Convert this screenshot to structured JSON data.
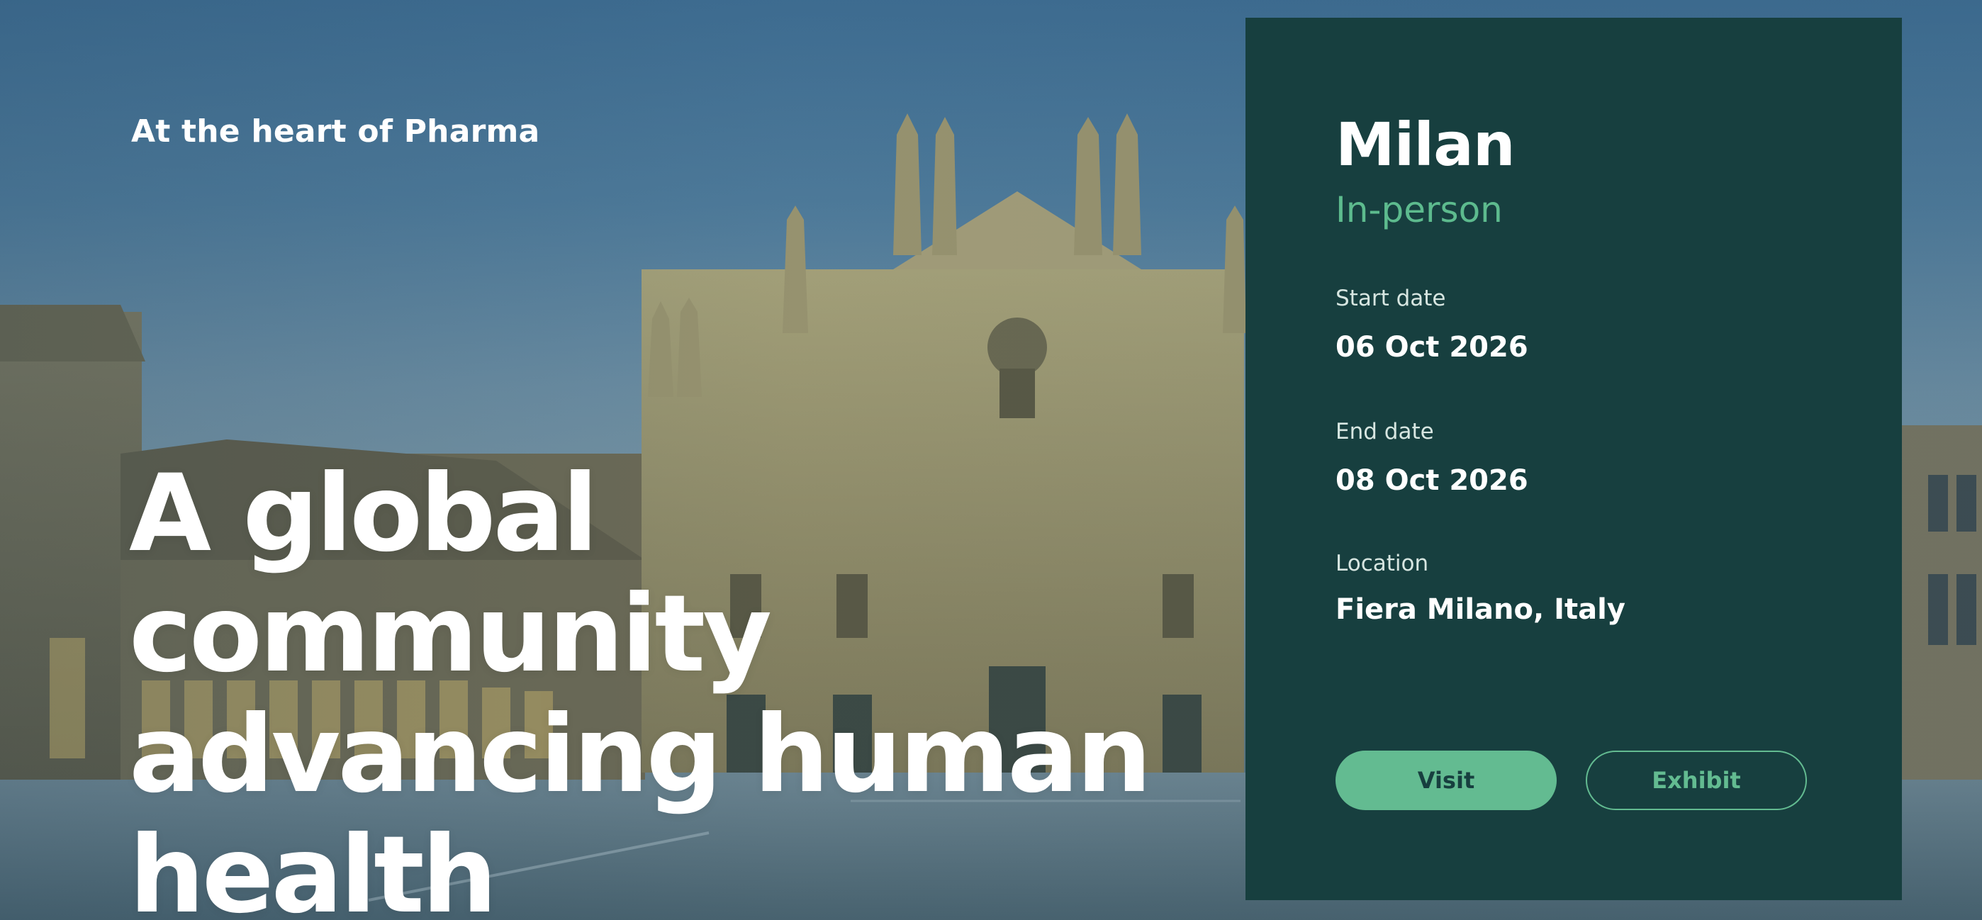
{
  "hero": {
    "eyebrow": "At the heart of Pharma",
    "headline_lines": [
      "A global community",
      "advancing human",
      "health"
    ],
    "background_image": "milan-cathedral-photo"
  },
  "event_card": {
    "city": "Milan",
    "mode": "In-person",
    "start_date_label": "Start date",
    "start_date": "06 Oct 2026",
    "end_date_label": "End date",
    "end_date": "08 Oct 2026",
    "location_label": "Location",
    "location": "Fiera Milano, Italy",
    "visit_label": "Visit",
    "exhibit_label": "Exhibit"
  },
  "colors": {
    "card_background": "#173f3f",
    "accent_green": "#63bb91",
    "text_white": "#ffffff"
  }
}
